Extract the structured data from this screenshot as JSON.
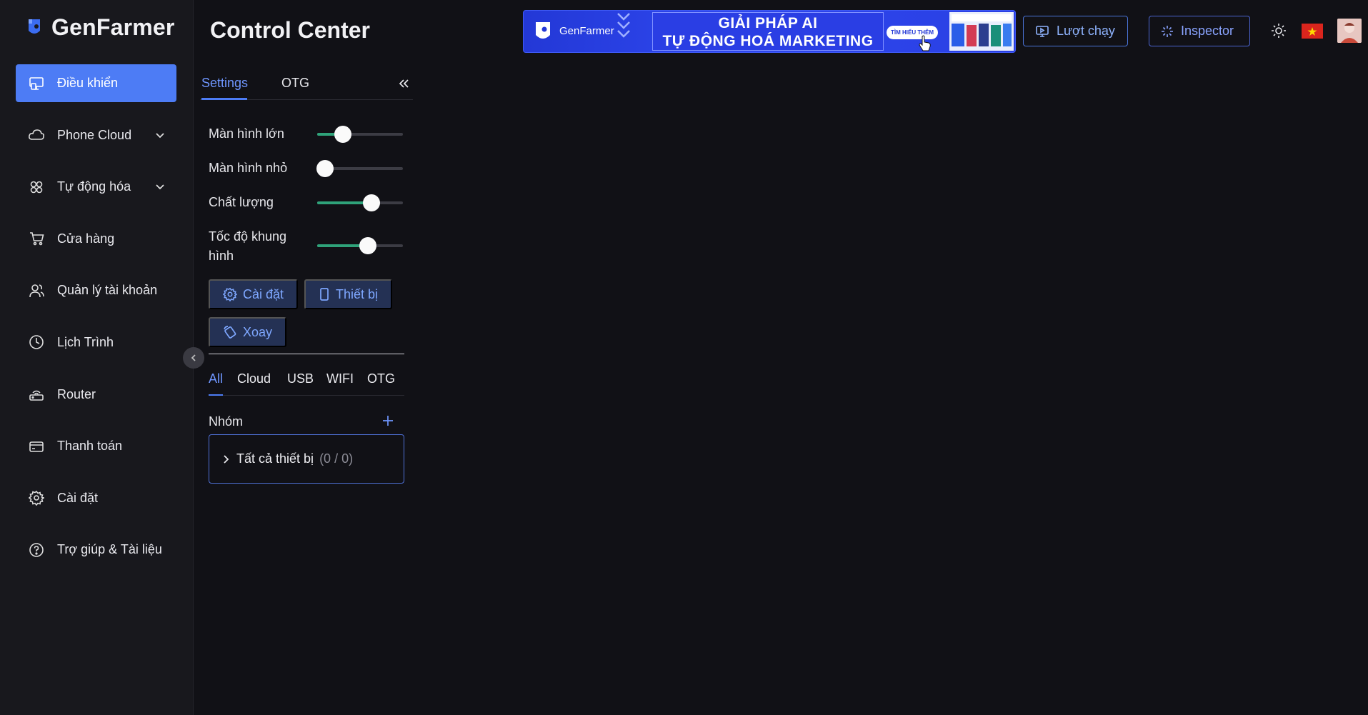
{
  "app": {
    "brand": "GenFarmer",
    "page_title": "Control Center"
  },
  "sidebar": {
    "items": [
      {
        "label": "Điều khiển",
        "icon": "monitor-icon",
        "active": true
      },
      {
        "label": "Phone Cloud",
        "icon": "cloud-icon",
        "expandable": true
      },
      {
        "label": "Tự động hóa",
        "icon": "automation-icon",
        "expandable": true
      },
      {
        "label": "Cửa hàng",
        "icon": "cart-icon"
      },
      {
        "label": "Quản lý tài khoản",
        "icon": "users-icon"
      },
      {
        "label": "Lịch Trình",
        "icon": "clock-icon"
      },
      {
        "label": "Router",
        "icon": "router-icon"
      },
      {
        "label": "Thanh toán",
        "icon": "card-icon"
      },
      {
        "label": "Cài đặt",
        "icon": "gear-icon"
      },
      {
        "label": "Trợ giúp & Tài liệu",
        "icon": "help-icon"
      }
    ]
  },
  "banner": {
    "brand": "GenFarmer",
    "line1": "GIẢI PHÁP AI",
    "line2": "TỰ ĐỘNG HOÁ MARKETING",
    "cta": "TÌM HIỂU THÊM"
  },
  "header": {
    "run_label": "Lượt chạy",
    "inspector_label": "Inspector"
  },
  "colors": {
    "accent": "#4d7cf5",
    "slider_fill": "#2fa37a",
    "background": "#111116",
    "sidebar": "#18181d",
    "flag_red": "#da251d"
  },
  "panel": {
    "tabs": [
      {
        "label": "Settings",
        "active": true
      },
      {
        "label": "OTG"
      }
    ],
    "sliders": [
      {
        "label": "Màn hình lớn",
        "value": 0.3
      },
      {
        "label": "Màn hình nhỏ",
        "value": 0.09
      },
      {
        "label": "Chất lượng",
        "value": 0.63
      },
      {
        "label": "Tốc độ khung hình",
        "value": 0.59
      }
    ],
    "buttons": {
      "settings": "Cài đặt",
      "device": "Thiết bị",
      "rotate": "Xoay"
    },
    "filter_tabs": [
      "All",
      "Cloud",
      "USB",
      "WIFI",
      "OTG"
    ],
    "group_label": "Nhóm",
    "group": {
      "name": "Tất cả thiết bị",
      "count": "(0 / 0)"
    }
  }
}
